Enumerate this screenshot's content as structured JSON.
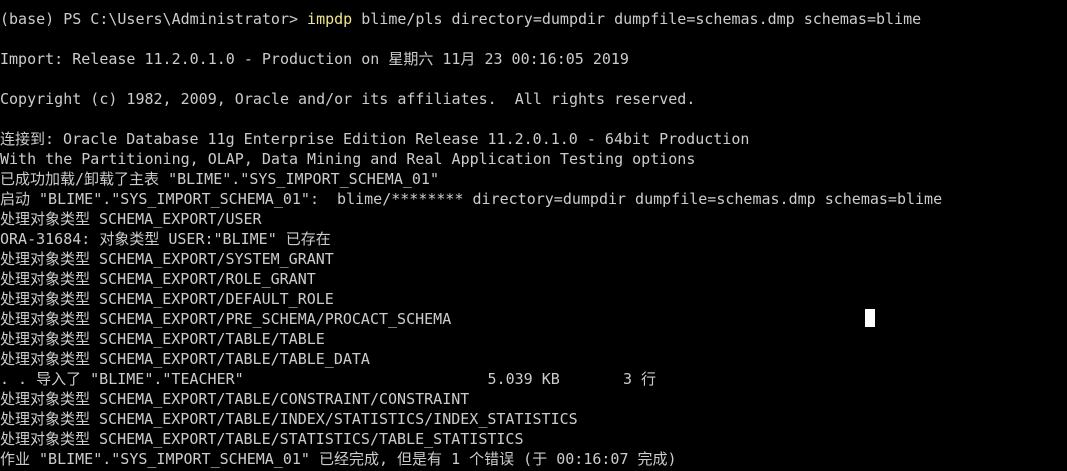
{
  "terminal": {
    "colors": {
      "background": "#000000",
      "text": "#cccccc",
      "command": "#f0e68c",
      "cursor": "#ffffff"
    },
    "prompt": {
      "prefix": "(base) PS C:\\Users\\Administrator> ",
      "command": "impdp",
      "args": " blime/pls directory=dumpdir dumpfile=schemas.dmp schemas=blime"
    },
    "output": [
      "Import: Release 11.2.0.1.0 - Production on 星期六 11月 23 00:16:05 2019",
      "Copyright (c) 1982, 2009, Oracle and/or its affiliates.  All rights reserved.",
      "连接到: Oracle Database 11g Enterprise Edition Release 11.2.0.1.0 - 64bit Production",
      "With the Partitioning, OLAP, Data Mining and Real Application Testing options",
      "已成功加载/卸载了主表 \"BLIME\".\"SYS_IMPORT_SCHEMA_01\"",
      "启动 \"BLIME\".\"SYS_IMPORT_SCHEMA_01\":  blime/******** directory=dumpdir dumpfile=schemas.dmp schemas=blime",
      "处理对象类型 SCHEMA_EXPORT/USER",
      "ORA-31684: 对象类型 USER:\"BLIME\" 已存在",
      "处理对象类型 SCHEMA_EXPORT/SYSTEM_GRANT",
      "处理对象类型 SCHEMA_EXPORT/ROLE_GRANT",
      "处理对象类型 SCHEMA_EXPORT/DEFAULT_ROLE",
      "处理对象类型 SCHEMA_EXPORT/PRE_SCHEMA/PROCACT_SCHEMA",
      "处理对象类型 SCHEMA_EXPORT/TABLE/TABLE",
      "处理对象类型 SCHEMA_EXPORT/TABLE/TABLE_DATA",
      ". . 导入了 \"BLIME\".\"TEACHER\"                           5.039 KB       3 行",
      "处理对象类型 SCHEMA_EXPORT/TABLE/CONSTRAINT/CONSTRAINT",
      "处理对象类型 SCHEMA_EXPORT/TABLE/INDEX/STATISTICS/INDEX_STATISTICS",
      "处理对象类型 SCHEMA_EXPORT/TABLE/STATISTICS/TABLE_STATISTICS",
      "作业 \"BLIME\".\"SYS_IMPORT_SCHEMA_01\" 已经完成, 但是有 1 个错误 (于 00:16:07 完成)"
    ]
  }
}
